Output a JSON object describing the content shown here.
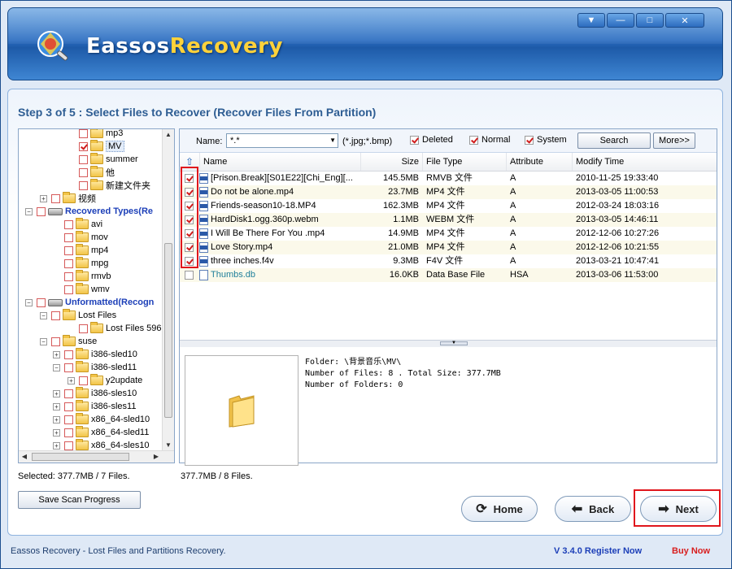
{
  "app": {
    "brand_part1": "Eassos",
    "brand_part2": "Recovery",
    "window_buttons": [
      "▼",
      "—",
      "□",
      "✕"
    ]
  },
  "step_title": "Step 3 of 5 : Select Files to Recover (Recover Files From Partition)",
  "tree": {
    "items": [
      {
        "label": "mp3",
        "checked": false
      },
      {
        "label": "MV",
        "checked": true,
        "selected": true
      },
      {
        "label": "summer",
        "checked": false
      },
      {
        "label": "他",
        "checked": false
      },
      {
        "label": "新建文件夹",
        "checked": false
      },
      {
        "label": "视频",
        "checked": false
      },
      {
        "label": "Recovered Types(Re",
        "checked": false
      },
      {
        "label": "avi",
        "checked": false
      },
      {
        "label": "mov",
        "checked": false
      },
      {
        "label": "mp4",
        "checked": false
      },
      {
        "label": "mpg",
        "checked": false
      },
      {
        "label": "rmvb",
        "checked": false
      },
      {
        "label": "wmv",
        "checked": false
      },
      {
        "label": "Unformatted(Recogn",
        "checked": false
      },
      {
        "label": "Lost Files",
        "checked": false
      },
      {
        "label": "Lost Files 596",
        "checked": false
      },
      {
        "label": "suse",
        "checked": false
      },
      {
        "label": "i386-sled10",
        "checked": false
      },
      {
        "label": "i386-sled11",
        "checked": false
      },
      {
        "label": "y2update",
        "checked": false
      },
      {
        "label": "i386-sles10",
        "checked": false
      },
      {
        "label": "i386-sles11",
        "checked": false
      },
      {
        "label": "x86_64-sled10",
        "checked": false
      },
      {
        "label": "x86_64-sled11",
        "checked": false
      },
      {
        "label": "x86_64-sles10",
        "checked": false
      }
    ]
  },
  "filter": {
    "name_label": "Name:",
    "name_value": "*.*",
    "hint": "(*.jpg;*.bmp)",
    "deleted_label": "Deleted",
    "normal_label": "Normal",
    "system_label": "System",
    "search_label": "Search",
    "more_label": "More>>"
  },
  "grid": {
    "headers": {
      "name": "Name",
      "size": "Size",
      "type": "File Type",
      "attr": "Attribute",
      "time": "Modify Time"
    },
    "rows": [
      {
        "name": "[Prison.Break][S01E22][Chi_Eng][...",
        "size": "145.5MB",
        "type": "RMVB 文件",
        "attr": "A",
        "time": "2010-11-25 19:33:40",
        "checked": true,
        "icon": "rmvb-file-icon"
      },
      {
        "name": "Do not be alone.mp4",
        "size": "23.7MB",
        "type": "MP4 文件",
        "attr": "A",
        "time": "2013-03-05 11:00:53",
        "checked": true,
        "icon": "mp4-file-icon"
      },
      {
        "name": "Friends-season10-18.MP4",
        "size": "162.3MB",
        "type": "MP4 文件",
        "attr": "A",
        "time": "2012-03-24 18:03:16",
        "checked": true,
        "icon": "mp4-file-icon"
      },
      {
        "name": "HardDisk1.ogg.360p.webm",
        "size": "1.1MB",
        "type": "WEBM 文件",
        "attr": "A",
        "time": "2013-03-05 14:46:11",
        "checked": true,
        "icon": "webm-file-icon"
      },
      {
        "name": "I Will Be There For You .mp4",
        "size": "14.9MB",
        "type": "MP4 文件",
        "attr": "A",
        "time": "2012-12-06 10:27:26",
        "checked": true,
        "icon": "mp4-file-icon"
      },
      {
        "name": "Love Story.mp4",
        "size": "21.0MB",
        "type": "MP4 文件",
        "attr": "A",
        "time": "2012-12-06 10:21:55",
        "checked": true,
        "icon": "mp4-file-icon"
      },
      {
        "name": "three inches.f4v",
        "size": "9.3MB",
        "type": "F4V 文件",
        "attr": "A",
        "time": "2013-03-21 10:47:41",
        "checked": true,
        "icon": "f4v-file-icon"
      },
      {
        "name": "Thumbs.db",
        "size": "16.0KB",
        "type": "Data Base File",
        "attr": "HSA",
        "time": "2013-03-06 11:53:00",
        "checked": false,
        "icon": "db-file-icon",
        "system": true
      }
    ]
  },
  "preview": {
    "info": "Folder: \\背景音乐\\MV\\\nNumber of Files: 8 . Total Size: 377.7MB\nNumber of Folders: 0"
  },
  "status": {
    "selected": "Selected: 377.7MB / 7 Files.",
    "total": "377.7MB / 8 Files."
  },
  "buttons": {
    "save_scan": "Save Scan Progress",
    "home": "Home",
    "back": "Back",
    "next": "Next"
  },
  "footer": {
    "left": "Eassos Recovery - Lost Files and Partitions Recovery.",
    "version": "V 3.4.0 Register Now",
    "buy": "Buy Now"
  },
  "colors": {
    "accent_blue": "#2e5d93",
    "highlight_red": "#e0161c",
    "brand_yellow": "#ffd23a"
  }
}
